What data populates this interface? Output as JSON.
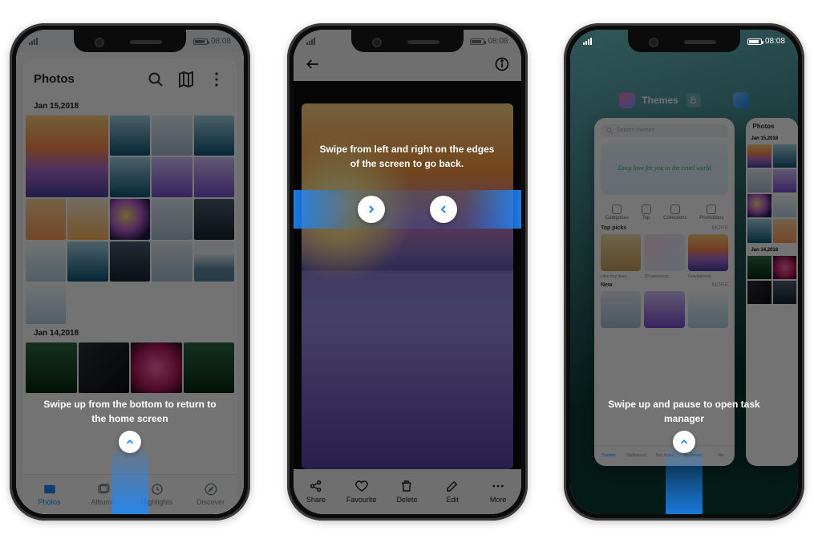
{
  "status": {
    "time": "08:08"
  },
  "phone1": {
    "app_title": "Photos",
    "dates": [
      "Jan 15,2018",
      "Jan 14,2018"
    ],
    "tabs": [
      {
        "label": "Photos",
        "active": true
      },
      {
        "label": "Albums",
        "active": false
      },
      {
        "label": "Highlights",
        "active": false
      },
      {
        "label": "Discover",
        "active": false
      }
    ],
    "tip": "Swipe up from the bottom to return to the home screen"
  },
  "phone2": {
    "tip": "Swipe from left and right on the edges of the screen to go back.",
    "toolbar": [
      {
        "label": "Share"
      },
      {
        "label": "Favourite"
      },
      {
        "label": "Delete"
      },
      {
        "label": "Edit"
      },
      {
        "label": "More"
      }
    ]
  },
  "phone3": {
    "tip": "Swipe up and pause to open task manager",
    "task_title": "Themes",
    "peek_title": "Photos",
    "peek_dates": [
      "Jan 15,2018",
      "Jan 14,2018"
    ],
    "themes": {
      "search_placeholder": "Search themes",
      "promo": "Deep love for you in the cruel world",
      "categories": [
        "Categories",
        "Top",
        "Collections",
        "Promotions"
      ],
      "top_picks_title": "Top picks",
      "more": "MORE",
      "picks": [
        "Little boy diary",
        "3D panoramic",
        "Gravitational"
      ],
      "new_title": "New",
      "tabs": [
        "Themes",
        "Wallpapers",
        "Text styles",
        "Ringtones",
        "Me"
      ]
    }
  }
}
